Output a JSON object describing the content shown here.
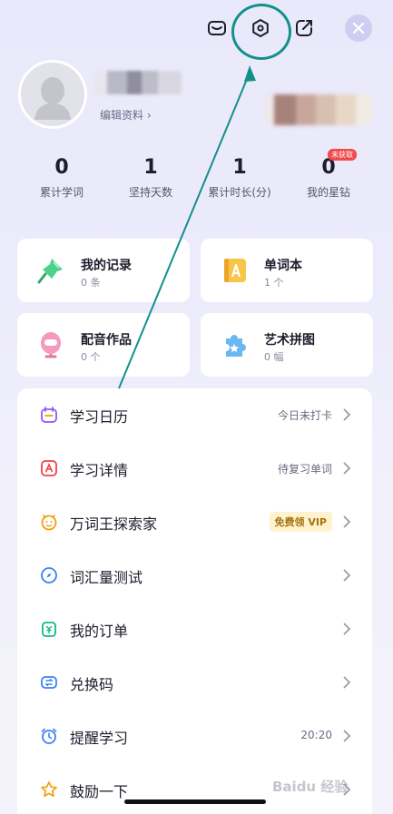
{
  "header": {
    "icons": [
      "mail-icon",
      "settings-icon",
      "share-icon",
      "close-icon"
    ]
  },
  "profile": {
    "edit_label": "编辑资料 ›"
  },
  "stats": [
    {
      "value": "0",
      "label": "累计学词"
    },
    {
      "value": "1",
      "label": "坚持天数"
    },
    {
      "value": "1",
      "label": "累计时长(分)"
    },
    {
      "value": "0",
      "label": "我的星钻",
      "badge": "未获取"
    }
  ],
  "cards": [
    {
      "title": "我的记录",
      "sub": "0 条",
      "icon": "pushpin-icon"
    },
    {
      "title": "单词本",
      "sub": "1 个",
      "icon": "word-book-icon"
    },
    {
      "title": "配音作品",
      "sub": "0 个",
      "icon": "microphone-icon"
    },
    {
      "title": "艺术拼图",
      "sub": "0 幅",
      "icon": "puzzle-icon"
    }
  ],
  "menu": [
    {
      "label": "学习日历",
      "value": "今日未打卡",
      "icon": "calendar-icon"
    },
    {
      "label": "学习详情",
      "value": "待复习单词",
      "icon": "study-detail-icon"
    },
    {
      "label": "万词王探索家",
      "vip": "免费领 VIP",
      "icon": "explorer-icon"
    },
    {
      "label": "词汇量测试",
      "value": "",
      "icon": "compass-icon"
    },
    {
      "label": "我的订单",
      "value": "",
      "icon": "order-icon"
    },
    {
      "label": "兑换码",
      "value": "",
      "icon": "redeem-code-icon"
    },
    {
      "label": "提醒学习",
      "value": "20:20",
      "icon": "alarm-icon"
    },
    {
      "label": "鼓励一下",
      "value": "",
      "icon": "star-icon"
    }
  ],
  "watermark": "Baidu 经验",
  "colors": {
    "annotation": "#14908a",
    "background": "#ecebfb",
    "badge_red": "#ef4b4b",
    "vip_bg": "#fff2cf"
  }
}
